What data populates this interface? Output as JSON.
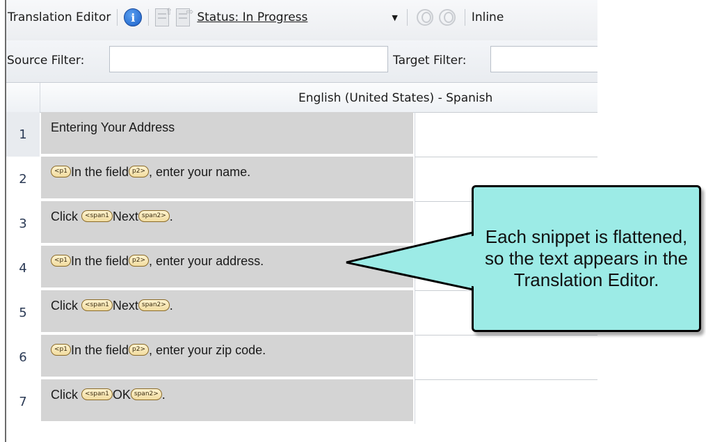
{
  "toolbar": {
    "title": "Translation Editor",
    "status_label": "Status: In Progress",
    "inline_label": "Inline"
  },
  "filters": {
    "source_label": "Source Filter:",
    "target_label": "Target Filter:",
    "source_value": "",
    "target_value": ""
  },
  "grid": {
    "column_title": "English (United States) - Spanish",
    "rows": [
      {
        "num": "1",
        "source": [
          {
            "t": "Entering Your Address"
          }
        ]
      },
      {
        "num": "2",
        "source": [
          {
            "tag": "<p1"
          },
          {
            "t": "In the field"
          },
          {
            "tag": "p2>"
          },
          {
            "t": ", enter your name."
          }
        ]
      },
      {
        "num": "3",
        "source": [
          {
            "t": "Click "
          },
          {
            "tag": "<span1"
          },
          {
            "t": "Next"
          },
          {
            "tag": "span2>"
          },
          {
            "t": "."
          }
        ]
      },
      {
        "num": "4",
        "source": [
          {
            "tag": "<p1"
          },
          {
            "t": "In the field"
          },
          {
            "tag": "p2>"
          },
          {
            "t": ", enter your address."
          }
        ]
      },
      {
        "num": "5",
        "source": [
          {
            "t": "Click "
          },
          {
            "tag": "<span1"
          },
          {
            "t": "Next"
          },
          {
            "tag": "span2>"
          },
          {
            "t": "."
          }
        ]
      },
      {
        "num": "6",
        "source": [
          {
            "tag": "<p1"
          },
          {
            "t": "In the field"
          },
          {
            "tag": "p2>"
          },
          {
            "t": ", enter your zip code."
          }
        ]
      },
      {
        "num": "7",
        "source": [
          {
            "t": "Click "
          },
          {
            "tag": "<span1"
          },
          {
            "t": "OK"
          },
          {
            "tag": "span2>"
          },
          {
            "t": "."
          }
        ]
      }
    ]
  },
  "callout": {
    "text": "Each snippet is flattened, so the text appears in the Translation Editor."
  },
  "colors": {
    "callout_fill": "#9cebe6",
    "source_cell": "#d4d4d4",
    "tag_fill": "#f1dca0"
  }
}
